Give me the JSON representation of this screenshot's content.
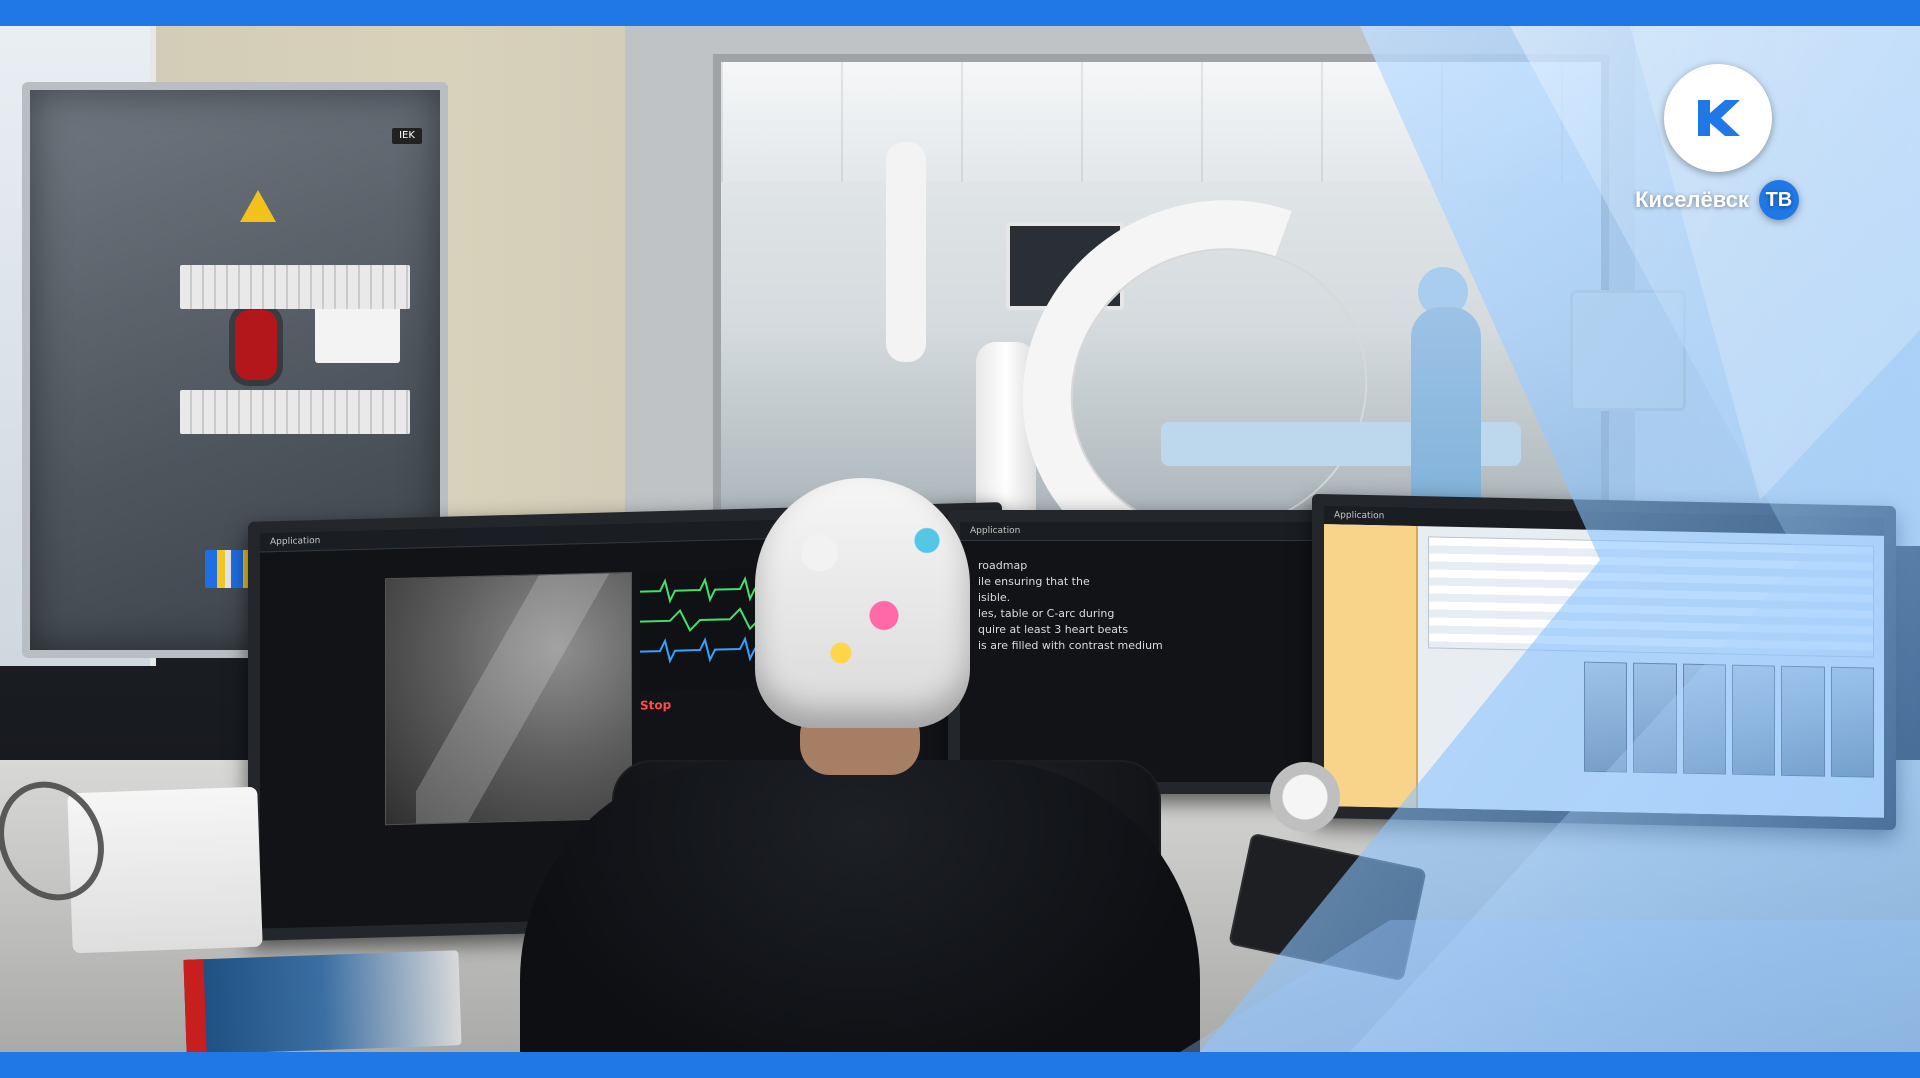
{
  "scene": {
    "description_labels": {
      "broadcaster_name": "Киселёвск",
      "broadcaster_suffix": "ТВ"
    },
    "colors": {
      "brand_blue": "#1F78E6",
      "overlay_light_blue": "#9CC8FF"
    }
  },
  "monitors": {
    "left": {
      "top_bar": "Application",
      "roadmap_lines": [
        "roadmap",
        "ile ensuring that the",
        "isible.",
        "les, table or C-arc during",
        "quire at least 3 heart beats",
        "is are filled with contrast medium"
      ],
      "alert_label": "Stop"
    },
    "center": {
      "top_bar": "Application"
    },
    "right": {
      "top_bar": "Application"
    }
  },
  "icons": {
    "brand_logo": "k-logo-icon",
    "tv_badge": "tv-badge-icon"
  }
}
